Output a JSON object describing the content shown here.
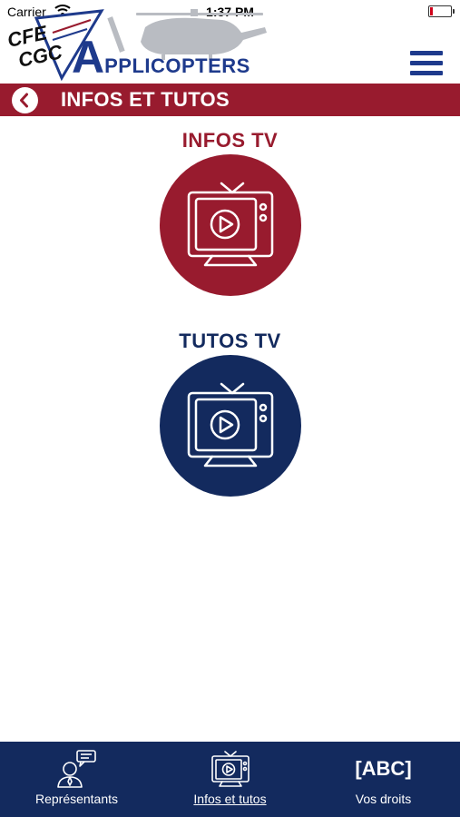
{
  "status_bar": {
    "carrier": "Carrier",
    "time": "1:37 PM"
  },
  "header": {
    "logo_text_1": "CFE",
    "logo_text_2": "CGC",
    "brand_initial": "A",
    "brand_rest": "PPLICOPTERS"
  },
  "title_bar": {
    "title": "INFOS ET TUTOS"
  },
  "sections": {
    "infos": {
      "title": "INFOS TV",
      "color": "#981b2e"
    },
    "tutos": {
      "title": "TUTOS TV",
      "color": "#132a5e"
    }
  },
  "tab_bar": {
    "items": [
      {
        "label": "Représentants",
        "icon": "person-chat-icon"
      },
      {
        "label": "Infos et tutos",
        "icon": "tv-play-icon",
        "active": true
      },
      {
        "label": "Vos droits",
        "icon_text": "[ABC]"
      }
    ]
  },
  "colors": {
    "primary_red": "#981b2e",
    "primary_navy": "#132a5e",
    "brand_blue": "#1e3a8c"
  }
}
